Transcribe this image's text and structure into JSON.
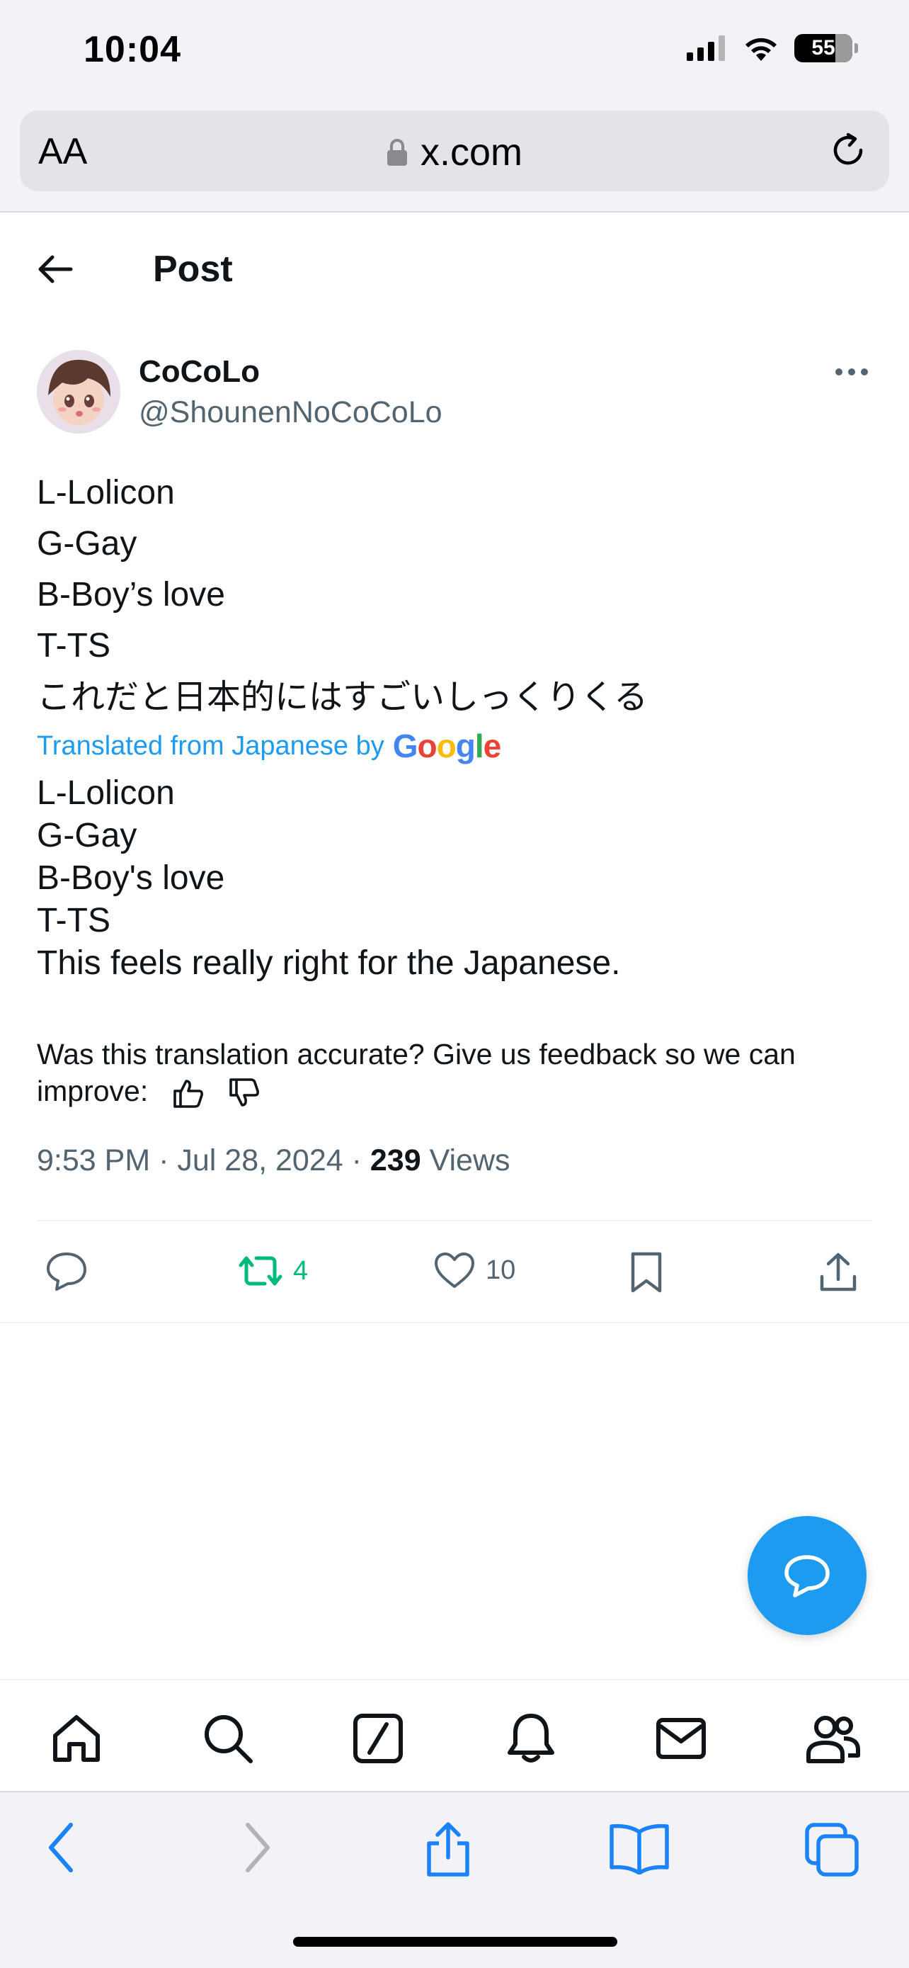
{
  "status_bar": {
    "time": "10:04",
    "battery": "55"
  },
  "browser": {
    "text_size_label": "AA",
    "url": "x.com"
  },
  "header": {
    "title": "Post"
  },
  "author": {
    "name": "CoCoLo",
    "handle": "@ShounenNoCoCoLo"
  },
  "post": {
    "lines": [
      "L-Lolicon",
      "G-Gay",
      "B-Boy’s love",
      "T-TS",
      "これだと日本的にはすごいしっくりくる"
    ],
    "translated_label": "Translated from Japanese by",
    "translated_provider": "Google",
    "translation_lines": [
      "L-Lolicon",
      "G-Gay",
      "B-Boy's love",
      "T-TS",
      "This feels really right for the Japanese."
    ],
    "feedback_text": "Was this translation accurate? Give us feedback so we can improve:",
    "time": "9:53 PM",
    "date": "Jul 28, 2024",
    "views_count": "239",
    "views_label": "Views"
  },
  "actions": {
    "reposts": "4",
    "likes": "10"
  },
  "colors": {
    "accent": "#1d9bf0",
    "repost": "#00ba7c",
    "muted": "#536471",
    "safari_blue": "#1a82fb"
  },
  "icons": {
    "header": [
      "back-arrow-icon",
      "more-icon"
    ],
    "actions": [
      "reply-icon",
      "repost-icon",
      "like-icon",
      "bookmark-icon",
      "share-icon"
    ],
    "nav": [
      "home-icon",
      "search-icon",
      "grok-icon",
      "notifications-icon",
      "messages-icon",
      "communities-icon"
    ],
    "safari": [
      "back-icon",
      "forward-icon",
      "share-icon",
      "bookmarks-icon",
      "tabs-icon"
    ]
  }
}
